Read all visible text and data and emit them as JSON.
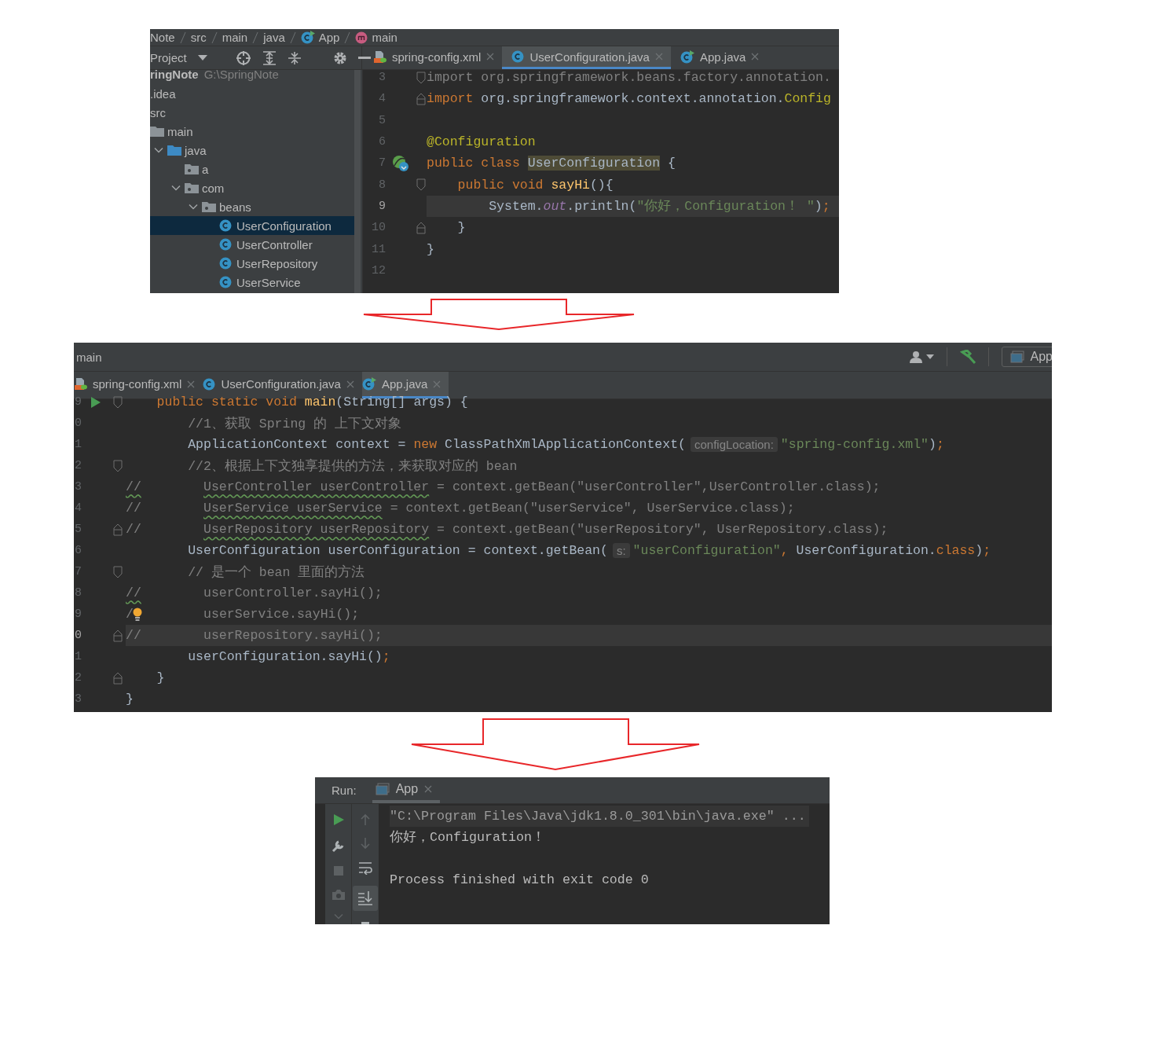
{
  "project_window": {
    "breadcrumbs": [
      {
        "label": "Note",
        "kind": "text"
      },
      {
        "label": "src",
        "kind": "text"
      },
      {
        "label": "main",
        "kind": "text"
      },
      {
        "label": "java",
        "kind": "text"
      },
      {
        "label": "App",
        "kind": "class"
      },
      {
        "label": "main",
        "kind": "method"
      }
    ],
    "project_label": "Project",
    "tree": {
      "root_name": "ringNote",
      "root_path": "G:\\SpringNote",
      "items": [
        {
          "label": ".idea",
          "selected": false
        },
        {
          "label": "src",
          "selected": false,
          "children": [
            {
              "label": "main",
              "kind": "folder",
              "selected": false,
              "children": [
                {
                  "label": "java",
                  "kind": "source-folder",
                  "expanded": true,
                  "selected": false,
                  "children": [
                    {
                      "label": "a",
                      "kind": "package",
                      "selected": false
                    },
                    {
                      "label": "com",
                      "kind": "package",
                      "expanded": true,
                      "selected": false,
                      "children": [
                        {
                          "label": "beans",
                          "kind": "package",
                          "expanded": true,
                          "selected": false,
                          "children": [
                            {
                              "label": "UserConfiguration",
                              "kind": "class",
                              "selected": true
                            },
                            {
                              "label": "UserController",
                              "kind": "class",
                              "selected": false
                            },
                            {
                              "label": "UserRepository",
                              "kind": "class",
                              "selected": false
                            },
                            {
                              "label": "UserService",
                              "kind": "class",
                              "selected": false
                            }
                          ]
                        }
                      ]
                    }
                  ]
                }
              ]
            }
          ]
        }
      ]
    },
    "editor": {
      "tabs": [
        {
          "label": "spring-config.xml",
          "kind": "xml",
          "selected": false
        },
        {
          "label": "UserConfiguration.java",
          "kind": "class",
          "selected": true
        },
        {
          "label": "App.java",
          "kind": "app",
          "selected": false
        }
      ],
      "lines": [
        {
          "number": "3",
          "kind": "block-start",
          "current": false,
          "tokens": [
            {
              "kind": "unused",
              "text": "import org.springframework.beans.factory.annotation."
            }
          ]
        },
        {
          "number": "4",
          "kind": "block-end",
          "current": false,
          "tokens": [
            {
              "kind": "keyword",
              "text": "import"
            },
            {
              "kind": "plain",
              "text": " org.springframework.context.annotation."
            },
            {
              "kind": "annotation",
              "text": "Config"
            }
          ]
        },
        {
          "number": "5",
          "kind": "plain",
          "current": false
        },
        {
          "number": "6",
          "kind": "plain",
          "current": false,
          "tokens": [
            {
              "kind": "annotation",
              "text": "@Configuration"
            }
          ]
        },
        {
          "number": "7",
          "kind": "bean-class",
          "current": false,
          "tokens": [
            {
              "kind": "keyword",
              "text": "public class "
            },
            {
              "kind": "highlight",
              "text": "UserConfiguration"
            },
            {
              "kind": "plain",
              "text": " {"
            }
          ]
        },
        {
          "number": "8",
          "kind": "block-start",
          "current": false,
          "tokens": [
            {
              "kind": "keyword",
              "text": "    public void "
            },
            {
              "kind": "method",
              "text": "sayHi"
            },
            {
              "kind": "plain",
              "text": "(){"
            }
          ]
        },
        {
          "number": "9",
          "kind": "plain",
          "current": true,
          "tokens": [
            {
              "kind": "plain",
              "text": "        System."
            },
            {
              "kind": "field",
              "text": "out"
            },
            {
              "kind": "plain",
              "text": ".println("
            },
            {
              "kind": "string",
              "text": "\"你好，Configuration！ \""
            },
            {
              "kind": "plain",
              "text": ")"
            },
            {
              "kind": "keyword",
              "text": ";"
            }
          ]
        },
        {
          "number": "10",
          "kind": "block-end",
          "current": false,
          "tokens": [
            {
              "kind": "plain",
              "text": "    }"
            }
          ]
        },
        {
          "number": "11",
          "kind": "plain",
          "current": false,
          "tokens": [
            {
              "kind": "plain",
              "text": "}"
            }
          ]
        },
        {
          "number": "12",
          "kind": "plain",
          "current": false
        }
      ]
    }
  },
  "editor_window": {
    "breadcrumb": "main",
    "run_config": "App",
    "tabs": [
      {
        "label": "spring-config.xml",
        "kind": "xml",
        "selected": false
      },
      {
        "label": "UserConfiguration.java",
        "kind": "class",
        "selected": false
      },
      {
        "label": "App.java",
        "kind": "app",
        "selected": true
      }
    ],
    "lines": [
      {
        "number": "9",
        "kind": "main-method",
        "current": false,
        "tokens": [
          {
            "kind": "keyword",
            "text": "    public static void "
          },
          {
            "kind": "method",
            "text": "main"
          },
          {
            "kind": "plain",
            "text": "(String[] args) {"
          }
        ]
      },
      {
        "number": "0",
        "kind": "plain",
        "current": false,
        "tokens": [
          {
            "kind": "comment",
            "text": "        //1、获取 Spring 的 上下文对象"
          }
        ]
      },
      {
        "number": "1",
        "kind": "plain",
        "current": false,
        "tokens": [
          {
            "kind": "plain",
            "text": "        ApplicationContext context = "
          },
          {
            "kind": "keyword",
            "text": "new"
          },
          {
            "kind": "plain",
            "text": " ClassPathXmlApplicationContext("
          },
          {
            "kind": "hint",
            "text": "configLocation:"
          },
          {
            "kind": "string",
            "text": "\"spring-config.xml\""
          },
          {
            "kind": "plain",
            "text": ")"
          },
          {
            "kind": "keyword",
            "text": ";"
          }
        ]
      },
      {
        "number": "2",
        "kind": "block-start",
        "current": false,
        "tokens": [
          {
            "kind": "comment",
            "text": "        //2、根据上下文独享提供的方法，来获取对应的 bean"
          }
        ]
      },
      {
        "number": "3",
        "kind": "plain",
        "current": false,
        "tokens": [
          {
            "kind": "typo",
            "text": "//"
          },
          {
            "kind": "typo",
            "text": "        UserController userController"
          },
          {
            "kind": "comment",
            "text": " = context.getBean(\"userController\",UserController.class);"
          }
        ]
      },
      {
        "number": "4",
        "kind": "plain",
        "current": false,
        "tokens": [
          {
            "kind": "comment",
            "text": "//"
          },
          {
            "kind": "typo",
            "text": "        UserService userService"
          },
          {
            "kind": "comment",
            "text": " = context.getBean(\"userService\", UserService.class);"
          }
        ]
      },
      {
        "number": "5",
        "kind": "block-end",
        "current": false,
        "tokens": [
          {
            "kind": "comment",
            "text": "//"
          },
          {
            "kind": "typo",
            "text": "        UserRepository userRepository"
          },
          {
            "kind": "comment",
            "text": " = context.getBean(\"userRepository\", UserRepository.class);"
          }
        ]
      },
      {
        "number": "6",
        "kind": "plain",
        "current": false,
        "tokens": [
          {
            "kind": "plain",
            "text": "        UserConfiguration userConfiguration = context.getBean("
          },
          {
            "kind": "hint",
            "text": "s:"
          },
          {
            "kind": "string",
            "text": "\"userConfiguration\""
          },
          {
            "kind": "keyword",
            "text": ","
          },
          {
            "kind": "plain",
            "text": " UserConfiguration."
          },
          {
            "kind": "keyword",
            "text": "class"
          },
          {
            "kind": "plain",
            "text": ")"
          },
          {
            "kind": "keyword",
            "text": ";"
          }
        ]
      },
      {
        "number": "7",
        "kind": "block-start",
        "current": false,
        "tokens": [
          {
            "kind": "comment",
            "text": "        // 是一个 bean 里面的方法"
          }
        ]
      },
      {
        "number": "8",
        "kind": "plain",
        "current": false,
        "tokens": [
          {
            "kind": "typo",
            "text": "//"
          },
          {
            "kind": "comment",
            "text": "        userController.sayHi();"
          }
        ]
      },
      {
        "number": "9",
        "kind": "hinted",
        "current": false,
        "tokens": [
          {
            "kind": "comment",
            "text": "/"
          },
          {
            "kind": "comment",
            "text": "        userService.sayHi();"
          }
        ]
      },
      {
        "number": "0",
        "kind": "block-end",
        "current": true,
        "tokens": [
          {
            "kind": "comment",
            "text": "//        userRepository.sayHi();"
          }
        ]
      },
      {
        "number": "1",
        "kind": "plain",
        "current": false,
        "tokens": [
          {
            "kind": "plain",
            "text": "        userConfiguration.sayHi()"
          },
          {
            "kind": "keyword",
            "text": ";"
          }
        ]
      },
      {
        "number": "2",
        "kind": "block-end",
        "current": false,
        "tokens": [
          {
            "kind": "plain",
            "text": "    }"
          }
        ]
      },
      {
        "number": "3",
        "kind": "plain",
        "current": false,
        "tokens": [
          {
            "kind": "plain",
            "text": "}"
          }
        ]
      }
    ]
  },
  "run_window": {
    "label": "Run:",
    "tabs": [
      {
        "label": "App",
        "selected": true
      }
    ],
    "left_tools": [
      {
        "kind": "run",
        "disabled": false
      },
      {
        "kind": "wrench",
        "disabled": false
      },
      {
        "kind": "stop",
        "disabled": true
      },
      {
        "kind": "camera",
        "disabled": true
      },
      {
        "kind": "expand",
        "disabled": true
      }
    ],
    "right_tools": [
      {
        "kind": "up",
        "disabled": true,
        "on": false
      },
      {
        "kind": "down",
        "disabled": true,
        "on": false
      },
      {
        "kind": "wrap",
        "disabled": false,
        "on": false
      },
      {
        "kind": "scroll-end",
        "disabled": false,
        "on": true
      },
      {
        "kind": "print",
        "disabled": false,
        "on": false
      }
    ],
    "output": [
      {
        "kind": "command",
        "text": "\"C:\\Program Files\\Java\\jdk1.8.0_301\\bin\\java.exe\" ..."
      },
      {
        "kind": "stdout",
        "text": "你好，Configuration！"
      },
      {
        "kind": "system",
        "text": "Process finished with exit code 0"
      }
    ]
  }
}
